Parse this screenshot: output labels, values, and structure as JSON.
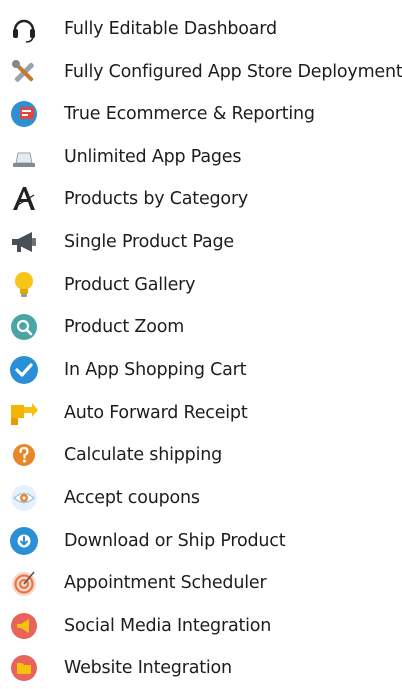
{
  "features": [
    {
      "label": "Fully Editable Dashboard",
      "icon": "headset-icon"
    },
    {
      "label": "Fully Configured App Store Deployment",
      "icon": "tools-icon"
    },
    {
      "label": "True Ecommerce & Reporting",
      "icon": "reporting-icon"
    },
    {
      "label": "Unlimited App Pages",
      "icon": "monitor-icon"
    },
    {
      "label": "Products by Category",
      "icon": "typography-icon"
    },
    {
      "label": "Single Product Page",
      "icon": "megaphone-icon"
    },
    {
      "label": "Product Gallery",
      "icon": "lightbulb-icon"
    },
    {
      "label": "Product Zoom",
      "icon": "zoom-icon"
    },
    {
      "label": "In App Shopping Cart",
      "icon": "checkmark-icon"
    },
    {
      "label": "Auto Forward Receipt",
      "icon": "forward-icon"
    },
    {
      "label": "Calculate shipping",
      "icon": "question-icon"
    },
    {
      "label": "Accept coupons",
      "icon": "eye-icon"
    },
    {
      "label": "Download or Ship Product",
      "icon": "download-icon"
    },
    {
      "label": "Appointment Scheduler",
      "icon": "target-icon"
    },
    {
      "label": "Social Media Integration",
      "icon": "social-megaphone-icon"
    },
    {
      "label": "Website Integration",
      "icon": "folder-icon"
    }
  ],
  "colors": {
    "text": "#1d1d1d",
    "blue": "#2a8fd6",
    "teal": "#4aa6a6",
    "yellow": "#f4c20d",
    "orange": "#e8862a",
    "red": "#d9453b"
  }
}
